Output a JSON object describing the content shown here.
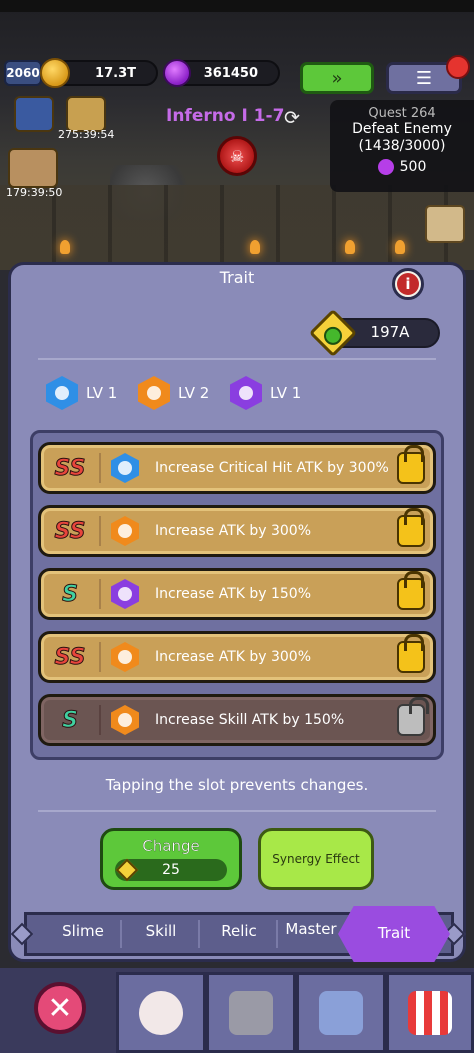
{
  "hud": {
    "level": "2060",
    "gold": "17.3T",
    "gems": "361450",
    "fast_forward_icon": "fast-forward-icon",
    "menu_icon": "list-icon"
  },
  "stage": {
    "name": "Inferno I 1-7"
  },
  "buffs": {
    "timer_1": "275:39:54",
    "timer_2": "179:39:50"
  },
  "quest": {
    "title": "Quest 264",
    "line1": "Defeat Enemy",
    "line2": "(1438/3000)",
    "reward": "500"
  },
  "panel": {
    "title": "Trait",
    "currency_value": "197A",
    "levels": [
      {
        "label": "LV 1",
        "color": "blue"
      },
      {
        "label": "LV 2",
        "color": "orange"
      },
      {
        "label": "LV 1",
        "color": "purple"
      }
    ],
    "slots": [
      {
        "grade": "SS",
        "icon_color": "blue",
        "text": "Increase Critical Hit ATK by 300%",
        "locked": true
      },
      {
        "grade": "SS",
        "icon_color": "orange",
        "text": "Increase ATK by 300%",
        "locked": true
      },
      {
        "grade": "S",
        "icon_color": "purple",
        "text": "Increase ATK by 150%",
        "locked": true
      },
      {
        "grade": "SS",
        "icon_color": "orange",
        "text": "Increase ATK by 300%",
        "locked": true
      },
      {
        "grade": "S",
        "icon_color": "orange",
        "text": "Increase Skill ATK by 150%",
        "locked": false
      }
    ],
    "hint": "Tapping the slot prevents changes.",
    "change_label": "Change",
    "change_cost": "25",
    "synergy_label": "Synergy Effect"
  },
  "tabs": [
    "Slime",
    "Skill",
    "Relic",
    "Master",
    "Trait"
  ],
  "active_tab": "Trait",
  "colors": {
    "panel": "#8a8bb8",
    "gold_slot": "#c9a058",
    "dark_slot": "#6b5552",
    "accent_green": "#5dc83a",
    "active_tab": "#9a4ce0"
  }
}
